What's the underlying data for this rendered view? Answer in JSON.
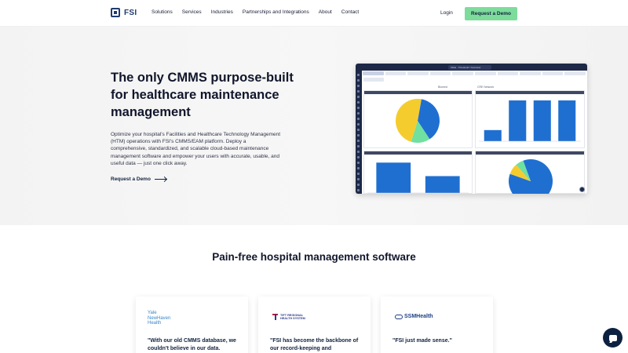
{
  "nav": {
    "logo_text": "FSI",
    "links": [
      "Solutions",
      "Services",
      "Industries",
      "Partnerships and Integrations",
      "About",
      "Contact"
    ],
    "login": "Login",
    "demo": "Request a Demo"
  },
  "hero": {
    "title": "The only CMMS purpose-built for healthcare maintenance management",
    "description": "Optimize your hospital's Facilities and Healthcare Technology Management (HTM) operations with FSI's CMMS/EAM platform. Deploy a comprehensive, standardized, and scalable cloud-based maintenance management software and empower your users with accurate, usable, and useful data — just one click away.",
    "cta": "Request a Demo"
  },
  "dashboard": {
    "tab_title": "Table · Threshold / Overview",
    "panel_left_title": "Biomed",
    "panel_right_title": "CRE Network",
    "pie1": [
      {
        "value": 38,
        "color": "#1f6fd1"
      },
      {
        "value": 14,
        "color": "#6fe0a0"
      },
      {
        "value": 48,
        "color": "#f5cc2e"
      }
    ],
    "bars1": [
      21,
      77,
      77,
      77
    ],
    "bars2": [
      72,
      40
    ],
    "pie2": [
      {
        "value": 86,
        "color": "#1f6fd1"
      },
      {
        "value": 8,
        "color": "#f5cc2e"
      },
      {
        "value": 6,
        "color": "#6fe0a0"
      }
    ],
    "bar_color": "#1f6fd1"
  },
  "section": {
    "title": "Pain-free hospital management software"
  },
  "cards": [
    {
      "logo": "Yale NewHaven Health",
      "logo_lines": [
        "Yale",
        "NewHaven",
        "Health"
      ],
      "quote": "\"With our old CMMS database, we couldn't believe in our data."
    },
    {
      "logo_lines": [
        "TIFT REGIONAL",
        "HEALTH SYSTEM"
      ],
      "quote": "\"FSI has become the backbone of our record-keeping and"
    },
    {
      "logo": "SSMHealth",
      "quote": "\"FSI just made sense.\""
    }
  ]
}
